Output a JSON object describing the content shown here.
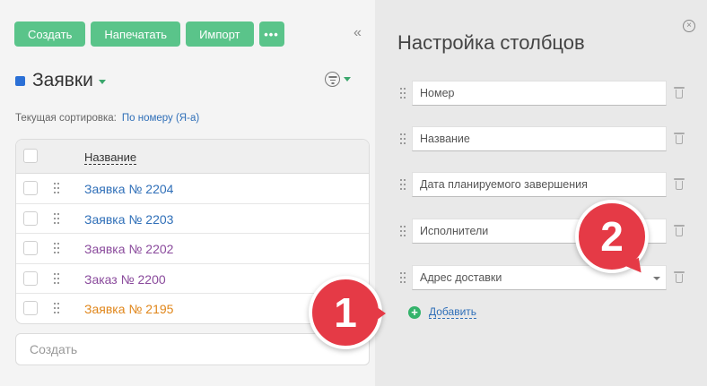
{
  "toolbar": {
    "create_label": "Создать",
    "print_label": "Напечатать",
    "import_label": "Импорт",
    "more_label": "•••",
    "collapse_label": "«"
  },
  "list": {
    "title": "Заявки",
    "accent_color": "#2b70d6",
    "sort_label": "Текущая сортировка:",
    "sort_value": "По номеру (Я-а)",
    "column_header": "Название",
    "rows": [
      {
        "name": "Заявка № 2204",
        "color": "#2f6fb8"
      },
      {
        "name": "Заявка № 2203",
        "color": "#2f6fb8"
      },
      {
        "name": "Заявка № 2202",
        "color": "#8a4a9c"
      },
      {
        "name": "Заказ № 2200",
        "color": "#8a4a9c"
      },
      {
        "name": "Заявка № 2195",
        "color": "#e0861a"
      }
    ],
    "create_placeholder": "Создать"
  },
  "panel": {
    "title": "Настройка столбцов",
    "close_label": "×",
    "columns": [
      {
        "value": "Номер"
      },
      {
        "value": "Название"
      },
      {
        "value": "Дата планируемого завершения"
      },
      {
        "value": "Исполнители"
      },
      {
        "value": "Адрес доставки"
      }
    ],
    "add_label": "Добавить",
    "add_icon": "+"
  },
  "callouts": {
    "one": "1",
    "two": "2"
  }
}
